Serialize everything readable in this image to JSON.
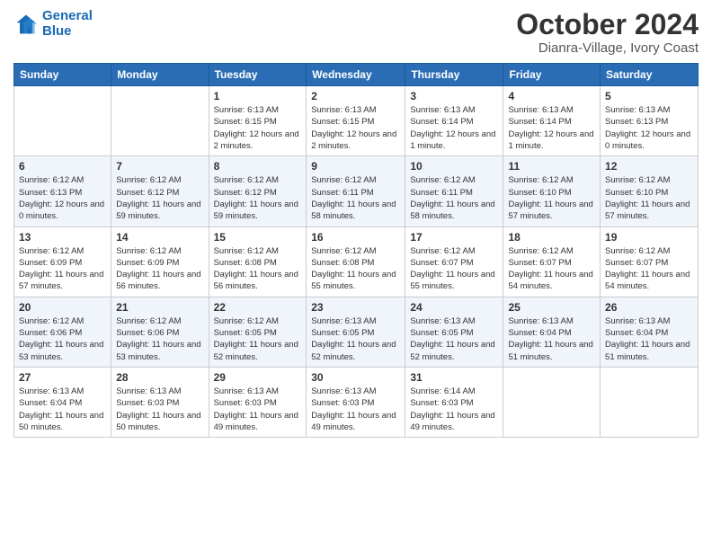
{
  "logo": {
    "line1": "General",
    "line2": "Blue"
  },
  "title": "October 2024",
  "subtitle": "Dianra-Village, Ivory Coast",
  "days_header": [
    "Sunday",
    "Monday",
    "Tuesday",
    "Wednesday",
    "Thursday",
    "Friday",
    "Saturday"
  ],
  "weeks": [
    [
      {
        "day": "",
        "info": ""
      },
      {
        "day": "",
        "info": ""
      },
      {
        "day": "1",
        "info": "Sunrise: 6:13 AM\nSunset: 6:15 PM\nDaylight: 12 hours and 2 minutes."
      },
      {
        "day": "2",
        "info": "Sunrise: 6:13 AM\nSunset: 6:15 PM\nDaylight: 12 hours and 2 minutes."
      },
      {
        "day": "3",
        "info": "Sunrise: 6:13 AM\nSunset: 6:14 PM\nDaylight: 12 hours and 1 minute."
      },
      {
        "day": "4",
        "info": "Sunrise: 6:13 AM\nSunset: 6:14 PM\nDaylight: 12 hours and 1 minute."
      },
      {
        "day": "5",
        "info": "Sunrise: 6:13 AM\nSunset: 6:13 PM\nDaylight: 12 hours and 0 minutes."
      }
    ],
    [
      {
        "day": "6",
        "info": "Sunrise: 6:12 AM\nSunset: 6:13 PM\nDaylight: 12 hours and 0 minutes."
      },
      {
        "day": "7",
        "info": "Sunrise: 6:12 AM\nSunset: 6:12 PM\nDaylight: 11 hours and 59 minutes."
      },
      {
        "day": "8",
        "info": "Sunrise: 6:12 AM\nSunset: 6:12 PM\nDaylight: 11 hours and 59 minutes."
      },
      {
        "day": "9",
        "info": "Sunrise: 6:12 AM\nSunset: 6:11 PM\nDaylight: 11 hours and 58 minutes."
      },
      {
        "day": "10",
        "info": "Sunrise: 6:12 AM\nSunset: 6:11 PM\nDaylight: 11 hours and 58 minutes."
      },
      {
        "day": "11",
        "info": "Sunrise: 6:12 AM\nSunset: 6:10 PM\nDaylight: 11 hours and 57 minutes."
      },
      {
        "day": "12",
        "info": "Sunrise: 6:12 AM\nSunset: 6:10 PM\nDaylight: 11 hours and 57 minutes."
      }
    ],
    [
      {
        "day": "13",
        "info": "Sunrise: 6:12 AM\nSunset: 6:09 PM\nDaylight: 11 hours and 57 minutes."
      },
      {
        "day": "14",
        "info": "Sunrise: 6:12 AM\nSunset: 6:09 PM\nDaylight: 11 hours and 56 minutes."
      },
      {
        "day": "15",
        "info": "Sunrise: 6:12 AM\nSunset: 6:08 PM\nDaylight: 11 hours and 56 minutes."
      },
      {
        "day": "16",
        "info": "Sunrise: 6:12 AM\nSunset: 6:08 PM\nDaylight: 11 hours and 55 minutes."
      },
      {
        "day": "17",
        "info": "Sunrise: 6:12 AM\nSunset: 6:07 PM\nDaylight: 11 hours and 55 minutes."
      },
      {
        "day": "18",
        "info": "Sunrise: 6:12 AM\nSunset: 6:07 PM\nDaylight: 11 hours and 54 minutes."
      },
      {
        "day": "19",
        "info": "Sunrise: 6:12 AM\nSunset: 6:07 PM\nDaylight: 11 hours and 54 minutes."
      }
    ],
    [
      {
        "day": "20",
        "info": "Sunrise: 6:12 AM\nSunset: 6:06 PM\nDaylight: 11 hours and 53 minutes."
      },
      {
        "day": "21",
        "info": "Sunrise: 6:12 AM\nSunset: 6:06 PM\nDaylight: 11 hours and 53 minutes."
      },
      {
        "day": "22",
        "info": "Sunrise: 6:12 AM\nSunset: 6:05 PM\nDaylight: 11 hours and 52 minutes."
      },
      {
        "day": "23",
        "info": "Sunrise: 6:13 AM\nSunset: 6:05 PM\nDaylight: 11 hours and 52 minutes."
      },
      {
        "day": "24",
        "info": "Sunrise: 6:13 AM\nSunset: 6:05 PM\nDaylight: 11 hours and 52 minutes."
      },
      {
        "day": "25",
        "info": "Sunrise: 6:13 AM\nSunset: 6:04 PM\nDaylight: 11 hours and 51 minutes."
      },
      {
        "day": "26",
        "info": "Sunrise: 6:13 AM\nSunset: 6:04 PM\nDaylight: 11 hours and 51 minutes."
      }
    ],
    [
      {
        "day": "27",
        "info": "Sunrise: 6:13 AM\nSunset: 6:04 PM\nDaylight: 11 hours and 50 minutes."
      },
      {
        "day": "28",
        "info": "Sunrise: 6:13 AM\nSunset: 6:03 PM\nDaylight: 11 hours and 50 minutes."
      },
      {
        "day": "29",
        "info": "Sunrise: 6:13 AM\nSunset: 6:03 PM\nDaylight: 11 hours and 49 minutes."
      },
      {
        "day": "30",
        "info": "Sunrise: 6:13 AM\nSunset: 6:03 PM\nDaylight: 11 hours and 49 minutes."
      },
      {
        "day": "31",
        "info": "Sunrise: 6:14 AM\nSunset: 6:03 PM\nDaylight: 11 hours and 49 minutes."
      },
      {
        "day": "",
        "info": ""
      },
      {
        "day": "",
        "info": ""
      }
    ]
  ]
}
